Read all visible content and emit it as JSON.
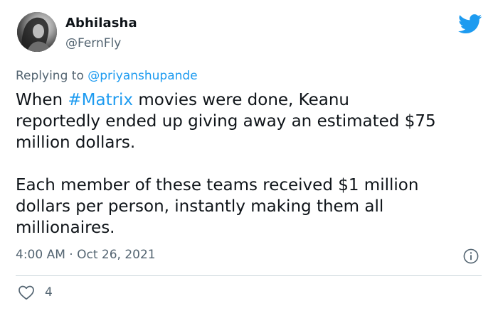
{
  "tweet": {
    "author_name": "Abhilasha",
    "author_handle": "@FernFly",
    "reply_prefix": "Replying to ",
    "reply_to_handle": "@priyanshupande",
    "text_line1_pre": "When ",
    "hashtag": "#Matrix",
    "text_line1_post": " movies were done, Keanu\nreportedly ended up giving away an estimated $75\nmillion dollars.\n\nEach member of these teams received $1 million\ndollars per person, instantly making them all\nmillionaires.",
    "timestamp": "4:00 AM · Oct 26, 2021",
    "like_count": "4"
  },
  "icons": {
    "brand": "twitter-bird-icon",
    "info": "info-icon",
    "like": "heart-icon"
  },
  "colors": {
    "link": "#1d9bf0",
    "secondary_text": "#536471",
    "primary_text": "#0f1419",
    "divider": "#cfd9de"
  }
}
